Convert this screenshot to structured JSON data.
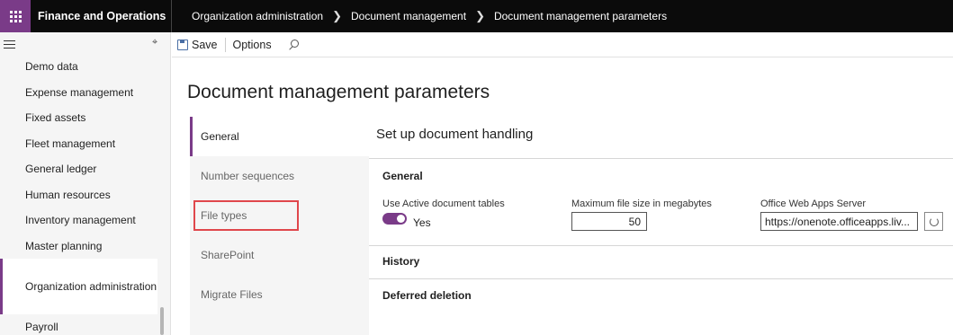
{
  "app": {
    "title": "Finance and Operations"
  },
  "breadcrumb": [
    "Organization administration",
    "Document management",
    "Document management parameters"
  ],
  "sidebar": {
    "items": [
      {
        "label": "Demo data"
      },
      {
        "label": "Expense management"
      },
      {
        "label": "Fixed assets"
      },
      {
        "label": "Fleet management"
      },
      {
        "label": "General ledger"
      },
      {
        "label": "Human resources"
      },
      {
        "label": "Inventory management"
      },
      {
        "label": "Master planning"
      },
      {
        "label": "Organization administration",
        "active": true
      },
      {
        "label": "Payroll"
      }
    ]
  },
  "toolbar": {
    "save_label": "Save",
    "options_label": "Options"
  },
  "page": {
    "title": "Document management parameters"
  },
  "tabs": [
    {
      "label": "General",
      "active": true
    },
    {
      "label": "Number sequences"
    },
    {
      "label": "File types",
      "highlighted": true
    },
    {
      "label": "SharePoint"
    },
    {
      "label": "Migrate Files"
    }
  ],
  "content": {
    "section_title": "Set up document handling",
    "general_group": "General",
    "use_active_label": "Use Active document tables",
    "use_active_value": "Yes",
    "max_size_label": "Maximum file size in megabytes",
    "max_size_value": "50",
    "office_label": "Office Web Apps Server",
    "office_value": "https://onenote.officeapps.liv...",
    "history_group": "History",
    "deferred_group": "Deferred deletion"
  },
  "colors": {
    "accent": "#7a3b88",
    "highlight": "#e0474c"
  }
}
